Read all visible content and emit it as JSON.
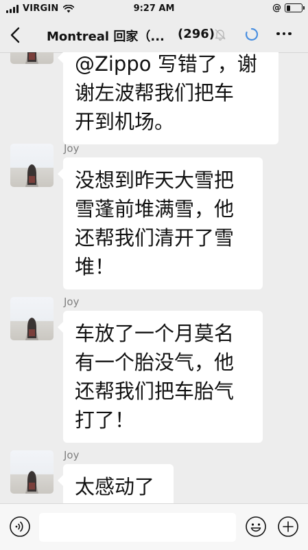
{
  "status_bar": {
    "carrier": "VIRGIN",
    "time": "9:27 AM",
    "rotation_lock": "@",
    "battery_level": 0.25
  },
  "nav": {
    "title": "Montreal 回家（...",
    "count": "(296)",
    "icons": [
      "back-arrow-icon",
      "mute-bell-icon",
      "loading-icon",
      "more-icon"
    ]
  },
  "messages": [
    {
      "sender": "",
      "lines": [
        "@Zippo 写错了，谢",
        "谢左波帮我们把车",
        "开到机场。"
      ]
    },
    {
      "sender": "Joy",
      "lines": [
        "没想到昨天大雪把",
        "雪蓬前堆满雪，他",
        "还帮我们清开了雪",
        "堆！"
      ]
    },
    {
      "sender": "Joy",
      "lines": [
        "车放了一个月莫名",
        "有一个胎没气，他",
        "还帮我们把车胎气",
        "打了！"
      ]
    },
    {
      "sender": "Joy",
      "lines": [
        "太感动了"
      ]
    }
  ],
  "input_bar": {
    "placeholder": "",
    "value": "",
    "icons": [
      "voice-icon",
      "emoji-icon",
      "plus-icon"
    ]
  }
}
